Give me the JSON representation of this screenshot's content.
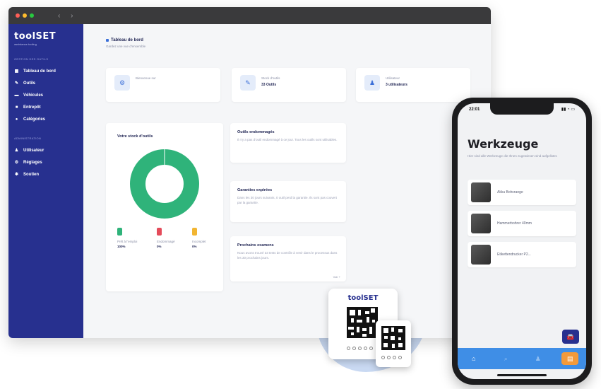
{
  "window": {
    "traffic_lights": [
      "#ff5f57",
      "#febc2e",
      "#28c840"
    ],
    "nav_arrows": "‹ ›"
  },
  "sidebar": {
    "logo": "toolSET",
    "logo_sub": "assistance tooling",
    "section_main": "GESTION DES OUTILS",
    "items": [
      {
        "label": "Tableau de bord",
        "icon": "grid-icon"
      },
      {
        "label": "Outils",
        "icon": "wrench-icon"
      },
      {
        "label": "Véhicules",
        "icon": "car-icon"
      },
      {
        "label": "Entrepôt",
        "icon": "warehouse-icon"
      },
      {
        "label": "Catégories",
        "icon": "tag-icon"
      }
    ],
    "section_admin": "ADMINISTRATION",
    "admin_items": [
      {
        "label": "Utilisateur",
        "icon": "user-icon"
      },
      {
        "label": "Réglages",
        "icon": "gear-icon"
      },
      {
        "label": "Soutien",
        "icon": "support-icon"
      }
    ]
  },
  "main": {
    "title": "Tableau de bord",
    "subtitle": "Gardez une vue d'ensemble",
    "stats": [
      {
        "label": "Bienvenue sur",
        "value": "",
        "icon": "gear-icon"
      },
      {
        "label": "Stock d'outils",
        "value": "33 Outils",
        "icon": "wrench-icon"
      },
      {
        "label": "Utilisateur",
        "value": "3 utilisateurs",
        "icon": "user-icon"
      }
    ],
    "stock_card": {
      "title": "Votre stock d'outils",
      "legend": [
        {
          "label": "Prêt à l'emploi",
          "pct": "100%",
          "color": "#2fb37a"
        },
        {
          "label": "Endommagé",
          "pct": "0%",
          "color": "#e44b5a"
        },
        {
          "label": "Incomplet",
          "pct": "0%",
          "color": "#f2b531"
        }
      ]
    },
    "info_cards": [
      {
        "title": "Outils endommagés",
        "text": "Il n'y a pas d'outil endommagé à ce jour. Tous les outils sont utilisables."
      },
      {
        "title": "Garanties expirées",
        "text": "Dans les 30 jours suivants, 0 outil perd la garantie. Ils sont pas couvert par la garantie."
      },
      {
        "title": "Prochains examens",
        "text": "Nous avons trouvé 33 tests de contrôle à venir dans le processus dans les 30 prochains jours."
      }
    ],
    "more_link": "Voir +"
  },
  "chart_data": {
    "type": "pie",
    "title": "Votre stock d'outils",
    "categories": [
      "Prêt à l'emploi",
      "Endommagé",
      "Incomplet"
    ],
    "values": [
      100,
      0,
      0
    ],
    "colors": [
      "#2fb37a",
      "#e44b5a",
      "#f2b531"
    ]
  },
  "qr": {
    "logo": "toolSET"
  },
  "mobile": {
    "time": "22:01",
    "status_icons": "▮▮ ◔ ▭",
    "title": "Werkzeuge",
    "subtitle": "Hier sind alle Werkzeuge die Ihnen zugewiesen sind aufgelistet.",
    "items": [
      {
        "label": "Akku Bohrzange"
      },
      {
        "label": "Hammerbohrer 40mm"
      },
      {
        "label": "Etikettendrucker P2..."
      }
    ],
    "tabs": [
      {
        "icon": "home-icon",
        "glyph": "⌂"
      },
      {
        "icon": "search-icon",
        "glyph": "⌕"
      },
      {
        "icon": "user-icon",
        "glyph": "♟"
      },
      {
        "icon": "toolbox-icon",
        "glyph": "▤"
      }
    ],
    "fab_glyph": "🚘"
  }
}
